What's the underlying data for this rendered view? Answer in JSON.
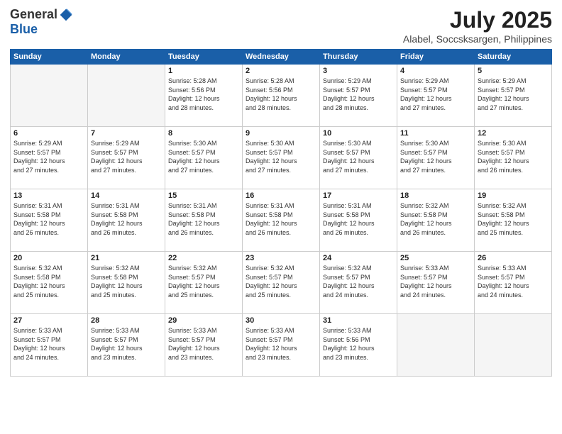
{
  "logo": {
    "general": "General",
    "blue": "Blue"
  },
  "title": {
    "month_year": "July 2025",
    "location": "Alabel, Soccsksargen, Philippines"
  },
  "days_of_week": [
    "Sunday",
    "Monday",
    "Tuesday",
    "Wednesday",
    "Thursday",
    "Friday",
    "Saturday"
  ],
  "weeks": [
    [
      {
        "day": "",
        "info": ""
      },
      {
        "day": "",
        "info": ""
      },
      {
        "day": "1",
        "info": "Sunrise: 5:28 AM\nSunset: 5:56 PM\nDaylight: 12 hours\nand 28 minutes."
      },
      {
        "day": "2",
        "info": "Sunrise: 5:28 AM\nSunset: 5:56 PM\nDaylight: 12 hours\nand 28 minutes."
      },
      {
        "day": "3",
        "info": "Sunrise: 5:29 AM\nSunset: 5:57 PM\nDaylight: 12 hours\nand 28 minutes."
      },
      {
        "day": "4",
        "info": "Sunrise: 5:29 AM\nSunset: 5:57 PM\nDaylight: 12 hours\nand 27 minutes."
      },
      {
        "day": "5",
        "info": "Sunrise: 5:29 AM\nSunset: 5:57 PM\nDaylight: 12 hours\nand 27 minutes."
      }
    ],
    [
      {
        "day": "6",
        "info": "Sunrise: 5:29 AM\nSunset: 5:57 PM\nDaylight: 12 hours\nand 27 minutes."
      },
      {
        "day": "7",
        "info": "Sunrise: 5:29 AM\nSunset: 5:57 PM\nDaylight: 12 hours\nand 27 minutes."
      },
      {
        "day": "8",
        "info": "Sunrise: 5:30 AM\nSunset: 5:57 PM\nDaylight: 12 hours\nand 27 minutes."
      },
      {
        "day": "9",
        "info": "Sunrise: 5:30 AM\nSunset: 5:57 PM\nDaylight: 12 hours\nand 27 minutes."
      },
      {
        "day": "10",
        "info": "Sunrise: 5:30 AM\nSunset: 5:57 PM\nDaylight: 12 hours\nand 27 minutes."
      },
      {
        "day": "11",
        "info": "Sunrise: 5:30 AM\nSunset: 5:57 PM\nDaylight: 12 hours\nand 27 minutes."
      },
      {
        "day": "12",
        "info": "Sunrise: 5:30 AM\nSunset: 5:57 PM\nDaylight: 12 hours\nand 26 minutes."
      }
    ],
    [
      {
        "day": "13",
        "info": "Sunrise: 5:31 AM\nSunset: 5:58 PM\nDaylight: 12 hours\nand 26 minutes."
      },
      {
        "day": "14",
        "info": "Sunrise: 5:31 AM\nSunset: 5:58 PM\nDaylight: 12 hours\nand 26 minutes."
      },
      {
        "day": "15",
        "info": "Sunrise: 5:31 AM\nSunset: 5:58 PM\nDaylight: 12 hours\nand 26 minutes."
      },
      {
        "day": "16",
        "info": "Sunrise: 5:31 AM\nSunset: 5:58 PM\nDaylight: 12 hours\nand 26 minutes."
      },
      {
        "day": "17",
        "info": "Sunrise: 5:31 AM\nSunset: 5:58 PM\nDaylight: 12 hours\nand 26 minutes."
      },
      {
        "day": "18",
        "info": "Sunrise: 5:32 AM\nSunset: 5:58 PM\nDaylight: 12 hours\nand 26 minutes."
      },
      {
        "day": "19",
        "info": "Sunrise: 5:32 AM\nSunset: 5:58 PM\nDaylight: 12 hours\nand 25 minutes."
      }
    ],
    [
      {
        "day": "20",
        "info": "Sunrise: 5:32 AM\nSunset: 5:58 PM\nDaylight: 12 hours\nand 25 minutes."
      },
      {
        "day": "21",
        "info": "Sunrise: 5:32 AM\nSunset: 5:58 PM\nDaylight: 12 hours\nand 25 minutes."
      },
      {
        "day": "22",
        "info": "Sunrise: 5:32 AM\nSunset: 5:57 PM\nDaylight: 12 hours\nand 25 minutes."
      },
      {
        "day": "23",
        "info": "Sunrise: 5:32 AM\nSunset: 5:57 PM\nDaylight: 12 hours\nand 25 minutes."
      },
      {
        "day": "24",
        "info": "Sunrise: 5:32 AM\nSunset: 5:57 PM\nDaylight: 12 hours\nand 24 minutes."
      },
      {
        "day": "25",
        "info": "Sunrise: 5:33 AM\nSunset: 5:57 PM\nDaylight: 12 hours\nand 24 minutes."
      },
      {
        "day": "26",
        "info": "Sunrise: 5:33 AM\nSunset: 5:57 PM\nDaylight: 12 hours\nand 24 minutes."
      }
    ],
    [
      {
        "day": "27",
        "info": "Sunrise: 5:33 AM\nSunset: 5:57 PM\nDaylight: 12 hours\nand 24 minutes."
      },
      {
        "day": "28",
        "info": "Sunrise: 5:33 AM\nSunset: 5:57 PM\nDaylight: 12 hours\nand 23 minutes."
      },
      {
        "day": "29",
        "info": "Sunrise: 5:33 AM\nSunset: 5:57 PM\nDaylight: 12 hours\nand 23 minutes."
      },
      {
        "day": "30",
        "info": "Sunrise: 5:33 AM\nSunset: 5:57 PM\nDaylight: 12 hours\nand 23 minutes."
      },
      {
        "day": "31",
        "info": "Sunrise: 5:33 AM\nSunset: 5:56 PM\nDaylight: 12 hours\nand 23 minutes."
      },
      {
        "day": "",
        "info": ""
      },
      {
        "day": "",
        "info": ""
      }
    ]
  ]
}
